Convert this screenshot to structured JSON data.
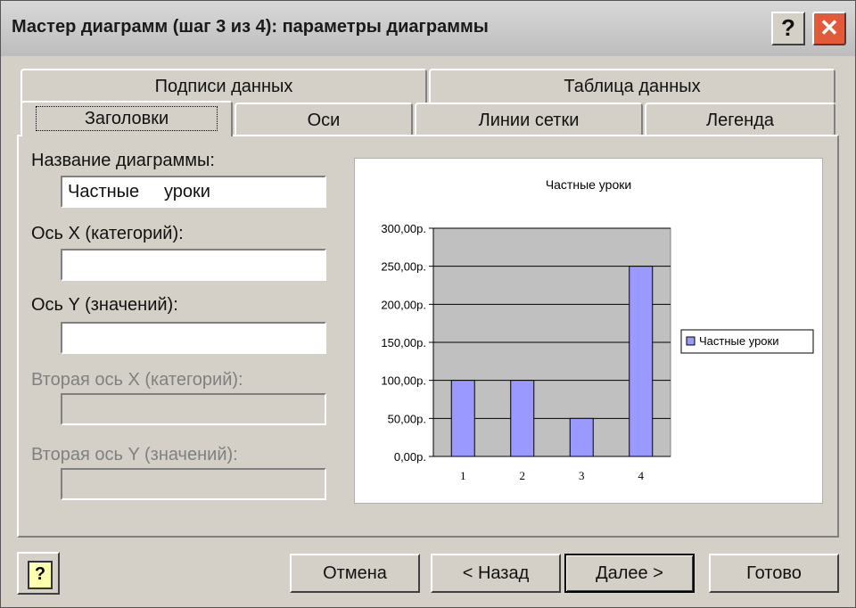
{
  "window": {
    "title": "Мастер диаграмм (шаг 3 из 4): параметры диаграммы",
    "help_glyph": "?",
    "close_glyph": "✕"
  },
  "tabs_back": [
    "Подписи данных",
    "Таблица данных"
  ],
  "tabs_front": [
    "Заголовки",
    "Оси",
    "Линии сетки",
    "Легенда"
  ],
  "form": {
    "chart_title_label": "Название диаграммы:",
    "chart_title_value": "Частные     уроки",
    "x_axis_label": "Ось X (категорий):",
    "x_axis_value": "",
    "y_axis_label": "Ось Y (значений):",
    "y_axis_value": "",
    "x2_axis_label": "Вторая ось X (категорий):",
    "y2_axis_label": "Вторая ось Y (значений):"
  },
  "chart_data": {
    "type": "bar",
    "title": "Частные     уроки",
    "categories": [
      "1",
      "2",
      "3",
      "4"
    ],
    "series": [
      {
        "name": "Частные     уроки",
        "values": [
          100,
          100,
          50,
          250
        ]
      }
    ],
    "ylim": [
      0,
      300
    ],
    "yticks": [
      "0,00р.",
      "50,00р.",
      "100,00р.",
      "150,00р.",
      "200,00р.",
      "250,00р.",
      "300,00р."
    ],
    "grid": true,
    "legend_placement": "right",
    "bar_color": "#9999ff",
    "plot_bg": "#c0c0c0"
  },
  "buttons": {
    "cancel": "Отмена",
    "back": "< Назад",
    "next": "Далее >",
    "finish": "Готово",
    "help": "?"
  }
}
